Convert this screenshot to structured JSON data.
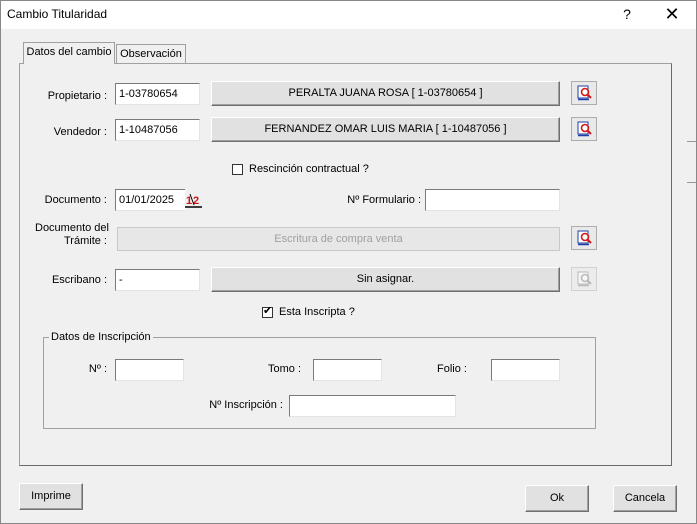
{
  "window": {
    "title": "Cambio Titularidad",
    "help_glyph": "?",
    "close_glyph": "✕"
  },
  "tabs": [
    {
      "label": "Datos del cambio",
      "active": true
    },
    {
      "label": "Observación",
      "active": false
    }
  ],
  "propietario": {
    "label": "Propietario :",
    "code": "1-03780654",
    "display": "PERALTA JUANA ROSA  [ 1-03780654 ]"
  },
  "vendedor": {
    "label": "Vendedor :",
    "code": "1-10487056",
    "display": "FERNANDEZ OMAR LUIS MARIA  [ 1-10487056 ]"
  },
  "rescision": {
    "label": "Rescinción contractual ?",
    "checked": false
  },
  "documento": {
    "label": "Documento :",
    "value": "01/01/2025",
    "calendar_icon_text": "12"
  },
  "formulario": {
    "label": "Nº Formulario :",
    "value": ""
  },
  "doc_tramite": {
    "label_line1": "Documento del",
    "label_line2": "Trámite :",
    "value": "Escritura de compra venta"
  },
  "escribano": {
    "label": "Escribano :",
    "code": "-",
    "display": "Sin asignar."
  },
  "inscripta": {
    "label": "Esta Inscripta ?",
    "checked": true,
    "check_glyph": "✔"
  },
  "inscripcion": {
    "legend": "Datos de Inscripción",
    "numero_label": "Nº :",
    "numero_value": "",
    "tomo_label": "Tomo :",
    "tomo_value": "",
    "folio_label": "Folio :",
    "folio_value": "",
    "nro_inscripcion_label": "Nº Inscripción :",
    "nro_inscripcion_value": ""
  },
  "footer": {
    "imprime": "Imprime",
    "ok": "Ok",
    "cancela": "Cancela"
  },
  "colors": {
    "search_icon_blue": "#1f3fa8",
    "search_icon_red": "#d01818",
    "window_bg": "#f0f0f0"
  },
  "icons": {
    "search": "search-icon",
    "calendar": "calendar-icon"
  }
}
